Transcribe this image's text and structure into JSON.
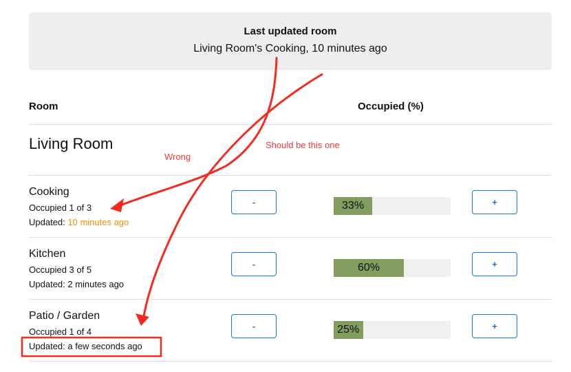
{
  "banner": {
    "title": "Last updated room",
    "text": "Living Room's Cooking, 10 minutes ago"
  },
  "table": {
    "col_room": "Room",
    "col_occupied": "Occupied (%)"
  },
  "group": {
    "name": "Living Room"
  },
  "rooms": [
    {
      "name": "Cooking",
      "occupied": "Occupied 1 of 3",
      "updated_label": "Updated: ",
      "updated_value": "10 minutes ago",
      "percent": 33,
      "percent_label": "33%",
      "minus": "-",
      "plus": "+"
    },
    {
      "name": "Kitchen",
      "occupied": "Occupied 3 of 5",
      "updated_label": "Updated: ",
      "updated_value": "2 minutes ago",
      "percent": 60,
      "percent_label": "60%",
      "minus": "-",
      "plus": "+"
    },
    {
      "name": "Patio / Garden",
      "occupied": "Occupied 1 of 4",
      "updated_label": "Updated: ",
      "updated_value": "a few seconds ago",
      "percent": 25,
      "percent_label": "25%",
      "minus": "-",
      "plus": "+"
    }
  ],
  "annotations": {
    "wrong": "Wrong",
    "should": "Should be this one"
  },
  "colors": {
    "accent": "#1a73d9",
    "bar_fill": "#819e5e",
    "highlight": "#f0900a",
    "annotation": "#f03a3a"
  }
}
